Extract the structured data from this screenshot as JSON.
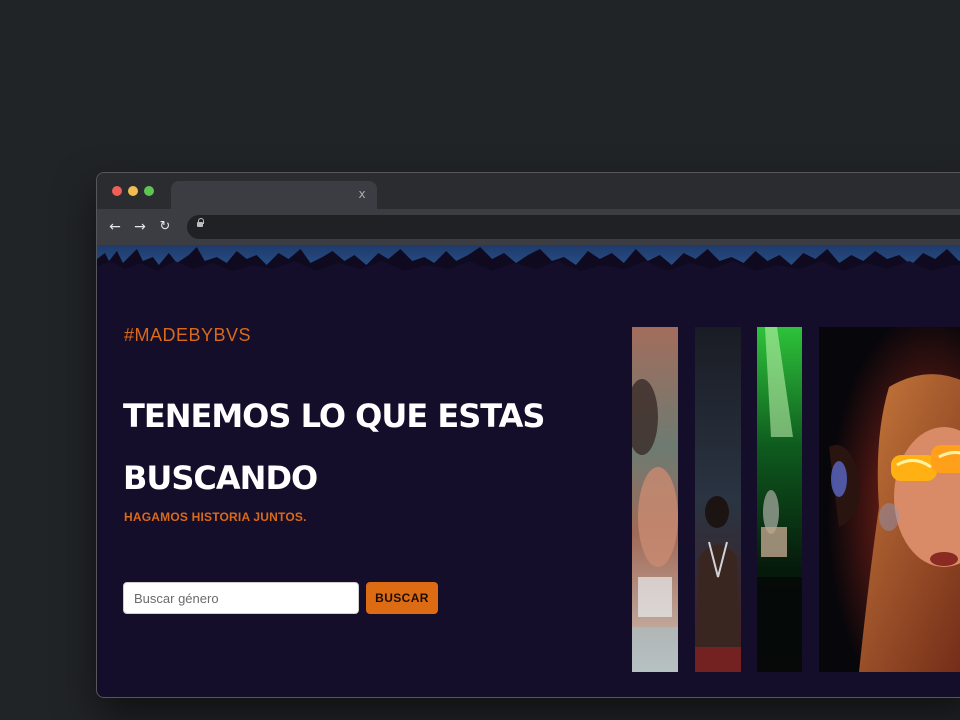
{
  "browser": {
    "tab": {
      "title": "",
      "close_label": "x"
    },
    "toolbar": {
      "back_icon": "arrow-left-icon",
      "forward_icon": "arrow-right-icon",
      "reload_icon": "reload-icon",
      "url": ""
    }
  },
  "hero": {
    "hashtag": "#MADEBYBVS",
    "headline": "TENEMOS LO QUE ESTAS BUSCANDO",
    "subtitle": "HAGAMOS HISTORIA JUNTOS.",
    "search": {
      "placeholder": "Buscar género",
      "value": "",
      "button_label": "BUSCAR"
    }
  },
  "colors": {
    "page_bg": "#140e2a",
    "accent": "#dd6b14",
    "desktop_bg": "#212427"
  }
}
